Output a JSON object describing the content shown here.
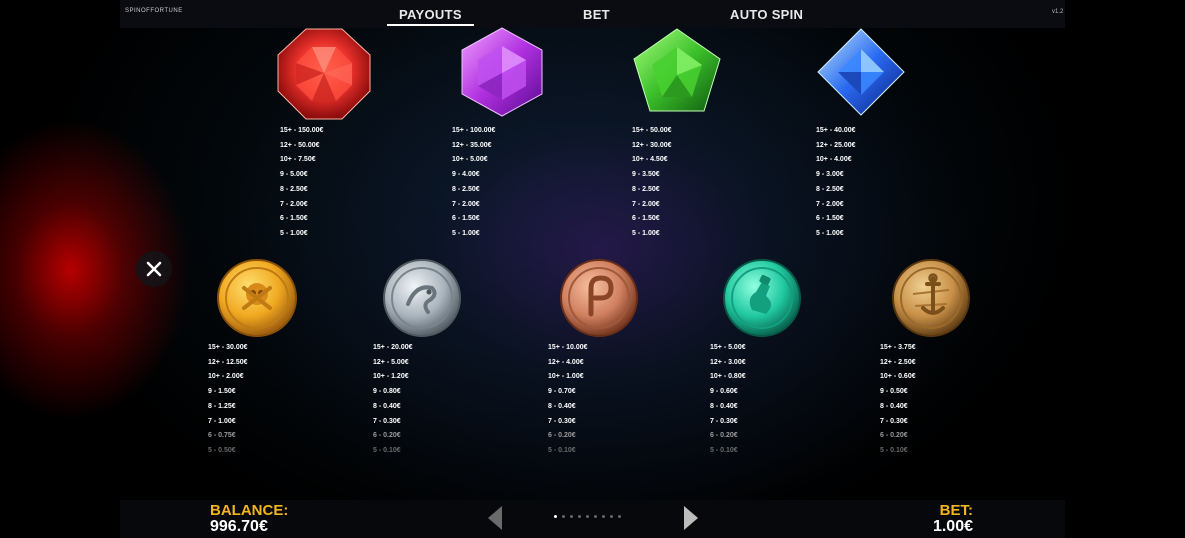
{
  "header": {
    "logo_text": "SPINOFFORTUNE",
    "version_text": "v1.2",
    "tabs": [
      {
        "label": "PAYOUTS",
        "active": true
      },
      {
        "label": "BET",
        "active": false
      },
      {
        "label": "AUTO SPIN",
        "active": false
      }
    ]
  },
  "symbols": {
    "red_gem": {
      "icon": "red-octagon-gem-icon",
      "color": "#e0302a",
      "payouts": [
        "15+ - 150.00€",
        "12+ - 50.00€",
        "10+ - 7.50€",
        "9 - 5.00€",
        "8 - 2.50€",
        "7 - 2.00€",
        "6 - 1.50€",
        "5 - 1.00€"
      ]
    },
    "purple_gem": {
      "icon": "purple-hexagon-gem-icon",
      "color": "#b030e0",
      "payouts": [
        "15+ - 100.00€",
        "12+ - 35.00€",
        "10+ - 5.00€",
        "9 - 4.00€",
        "8 - 2.50€",
        "7 - 2.00€",
        "6 - 1.50€",
        "5 - 1.00€"
      ]
    },
    "green_gem": {
      "icon": "green-pentagon-gem-icon",
      "color": "#3cc02a",
      "payouts": [
        "15+ - 50.00€",
        "12+ - 30.00€",
        "10+ - 4.50€",
        "9 - 3.50€",
        "8 - 2.50€",
        "7 - 2.00€",
        "6 - 1.50€",
        "5 - 1.00€"
      ]
    },
    "blue_gem": {
      "icon": "blue-diamond-gem-icon",
      "color": "#2a6af0",
      "payouts": [
        "15+ - 40.00€",
        "12+ - 25.00€",
        "10+ - 4.00€",
        "9 - 3.00€",
        "8 - 2.50€",
        "7 - 2.00€",
        "6 - 1.50€",
        "5 - 1.00€"
      ]
    },
    "gold_coin": {
      "icon": "gold-skull-coin-icon",
      "color": "#f0a820",
      "payouts": [
        "15+ - 30.00€",
        "12+ - 12.50€",
        "10+ - 2.00€",
        "9 - 1.50€",
        "8 - 1.25€",
        "7 - 1.00€",
        "6 - 0.75€",
        "5 - 0.50€"
      ]
    },
    "silver_coin": {
      "icon": "silver-parrot-coin-icon",
      "color": "#aab4bc",
      "payouts": [
        "15+ - 20.00€",
        "12+ - 5.00€",
        "10+ - 1.20€",
        "9 - 0.80€",
        "8 - 0.40€",
        "7 - 0.30€",
        "6 - 0.20€",
        "5 - 0.10€"
      ]
    },
    "copper_coin": {
      "icon": "copper-hook-coin-icon",
      "color": "#d08060",
      "payouts": [
        "15+ - 10.00€",
        "12+ - 4.00€",
        "10+ - 1.00€",
        "9 - 0.70€",
        "8 - 0.40€",
        "7 - 0.30€",
        "6 - 0.20€",
        "5 - 0.10€"
      ]
    },
    "teal_coin": {
      "icon": "teal-bottle-coin-icon",
      "color": "#20c8a0",
      "payouts": [
        "15+ - 5.00€",
        "12+ - 3.00€",
        "10+ - 0.80€",
        "9 - 0.60€",
        "8 - 0.40€",
        "7 - 0.30€",
        "6 - 0.20€",
        "5 - 0.10€"
      ]
    },
    "bronze_coin": {
      "icon": "bronze-anchor-coin-icon",
      "color": "#c89048",
      "payouts": [
        "15+ - 3.75€",
        "12+ - 2.50€",
        "10+ - 0.60€",
        "9 - 0.50€",
        "8 - 0.40€",
        "7 - 0.30€",
        "6 - 0.20€",
        "5 - 0.10€"
      ]
    }
  },
  "footer": {
    "balance_label": "BALANCE:",
    "balance_value": "996.70€",
    "bet_label": "BET:",
    "bet_value": "1.00€",
    "page_count": 9,
    "current_page": 1
  }
}
